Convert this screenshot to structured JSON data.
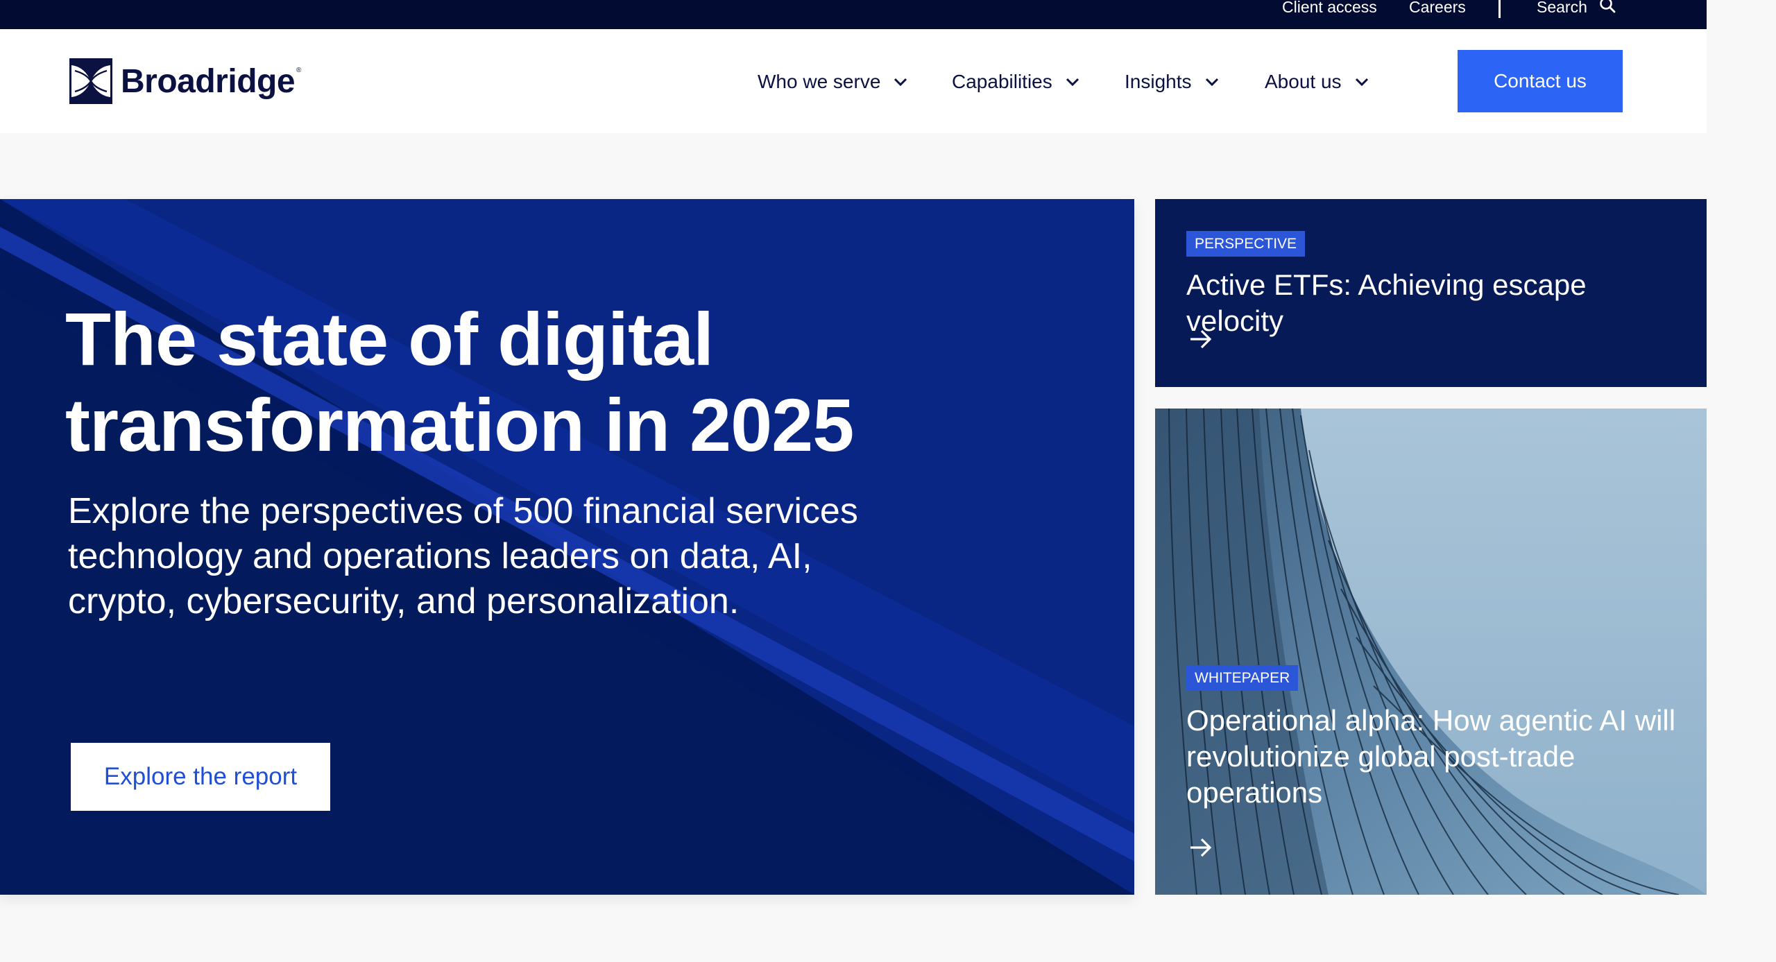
{
  "utility": {
    "client_access": "Client access",
    "careers": "Careers",
    "search": "Search"
  },
  "header": {
    "logo_text": "Broadridge",
    "logo_reg": "®",
    "nav": [
      {
        "label": "Who we serve"
      },
      {
        "label": "Capabilities"
      },
      {
        "label": "Insights"
      },
      {
        "label": "About us"
      }
    ],
    "contact_label": "Contact us"
  },
  "hero": {
    "title": "The state of digital transformation in 2025",
    "subtitle": "Explore the perspectives of 500 financial services technology and operations leaders on data, AI, crypto, cybersecurity, and personalization.",
    "cta_label": "Explore the report"
  },
  "cards": [
    {
      "badge": "PERSPECTIVE",
      "title": "Active ETFs: Achieving escape velocity"
    },
    {
      "badge": "WHITEPAPER",
      "title": "Operational alpha: How agentic AI will revolutionize global post-trade operations"
    }
  ],
  "colors": {
    "utility_bg": "#020c33",
    "brand_navy": "#0b1140",
    "accent_blue": "#2c64f6",
    "hero_bg": "#041d68",
    "card_dark": "#061a58",
    "badge_blue": "#2b56d8"
  },
  "icons": {
    "search": "search-icon",
    "chevron": "chevron-down-icon",
    "arrow": "arrow-right-icon",
    "logo": "broadridge-logo-mark"
  }
}
